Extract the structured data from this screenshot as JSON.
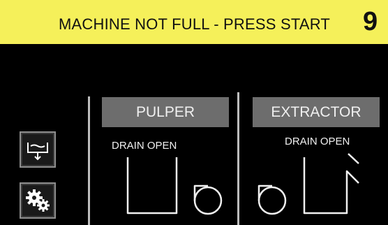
{
  "banner": {
    "message": "MACHINE NOT FULL - PRESS START",
    "number": "9",
    "color": "#f5f05a"
  },
  "side_buttons": [
    {
      "icon": "tank-drain-icon"
    },
    {
      "icon": "gears-icon"
    }
  ],
  "pulper": {
    "title": "PULPER",
    "drain_status": "DRAIN OPEN"
  },
  "extractor": {
    "title": "EXTRACTOR",
    "drain_status": "DRAIN OPEN"
  },
  "colors": {
    "button_bg": "#6d6d6d",
    "text": "#f0f0f0",
    "background": "#000000"
  }
}
